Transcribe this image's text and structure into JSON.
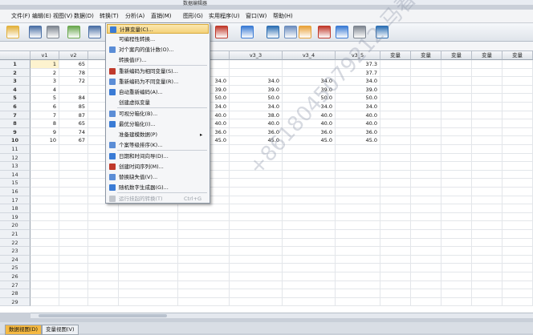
{
  "window": {
    "title": "数据编辑器"
  },
  "menubar": [
    {
      "label": "文件(F)"
    },
    {
      "label": "编辑(E)"
    },
    {
      "label": "视图(V)"
    },
    {
      "label": "数据(D)"
    },
    {
      "label": "转换(T)"
    },
    {
      "label": "分析(A)"
    },
    {
      "label": "直销(M)"
    },
    {
      "label": "图形(G)"
    },
    {
      "label": "实用程序(U)"
    },
    {
      "label": "窗口(W)"
    },
    {
      "label": "帮助(H)"
    }
  ],
  "columns": [
    "v1",
    "v2",
    "",
    "",
    "",
    "v3_3",
    "v3_4",
    "v3_5",
    "变量",
    "变量",
    "变量",
    "变量",
    "变量"
  ],
  "rows": [
    {
      "n": "1",
      "cells": [
        "1",
        "65",
        "",
        "",
        "",
        "",
        "",
        "37.3"
      ]
    },
    {
      "n": "2",
      "cells": [
        "2",
        "78",
        "",
        "",
        "",
        "",
        "",
        "37.7"
      ]
    },
    {
      "n": "3",
      "cells": [
        "3",
        "72",
        "",
        "",
        "34.0",
        "34.0",
        "34.0",
        "34.0"
      ]
    },
    {
      "n": "4",
      "cells": [
        "4",
        "",
        "",
        "",
        "39.0",
        "39.0",
        "39.0",
        "39.0"
      ]
    },
    {
      "n": "5",
      "cells": [
        "5",
        "84",
        "",
        "",
        "50.0",
        "50.0",
        "50.0",
        "50.0"
      ]
    },
    {
      "n": "6",
      "cells": [
        "6",
        "85",
        "",
        "",
        "34.0",
        "34.0",
        "34.0",
        "34.0"
      ]
    },
    {
      "n": "7",
      "cells": [
        "7",
        "87",
        "",
        "",
        "40.0",
        "38.0",
        "40.0",
        "40.0"
      ]
    },
    {
      "n": "8",
      "cells": [
        "8",
        "65",
        "",
        "",
        "40.0",
        "40.0",
        "40.0",
        "40.0"
      ]
    },
    {
      "n": "9",
      "cells": [
        "9",
        "74",
        "",
        "",
        "36.0",
        "36.0",
        "36.0",
        "36.0"
      ]
    },
    {
      "n": "10",
      "cells": [
        "10",
        "67",
        "",
        "",
        "45.0",
        "45.0",
        "45.0",
        "45.0"
      ]
    },
    {
      "n": "11",
      "cells": []
    },
    {
      "n": "12",
      "cells": []
    },
    {
      "n": "13",
      "cells": []
    },
    {
      "n": "14",
      "cells": []
    },
    {
      "n": "15",
      "cells": []
    },
    {
      "n": "16",
      "cells": []
    },
    {
      "n": "17",
      "cells": []
    },
    {
      "n": "18",
      "cells": []
    },
    {
      "n": "19",
      "cells": []
    },
    {
      "n": "20",
      "cells": []
    },
    {
      "n": "21",
      "cells": []
    },
    {
      "n": "22",
      "cells": []
    },
    {
      "n": "23",
      "cells": []
    },
    {
      "n": "24",
      "cells": []
    },
    {
      "n": "25",
      "cells": []
    },
    {
      "n": "26",
      "cells": []
    },
    {
      "n": "27",
      "cells": []
    },
    {
      "n": "28",
      "cells": []
    },
    {
      "n": "29",
      "cells": []
    }
  ],
  "dropdown": {
    "items": [
      {
        "label": "计算变量(C)...",
        "icon": "calculator-icon",
        "highlighted": true
      },
      {
        "label": "可编程性转换...",
        "icon": ""
      },
      {
        "label": "对个案内的值计数(O)...",
        "icon": "count-icon"
      },
      {
        "label": "转换值(F)...",
        "icon": ""
      },
      {
        "label": "重新编码为相同变量(S)...",
        "icon": "recode-same-icon"
      },
      {
        "label": "重新编码为不同变量(R)...",
        "icon": "recode-diff-icon"
      },
      {
        "label": "自动重新编码(A)...",
        "icon": "auto-recode-icon"
      },
      {
        "label": "创建虚拟变量",
        "icon": ""
      },
      {
        "label": "可视分箱化(B)...",
        "icon": "binning-icon"
      },
      {
        "label": "最优分箱化(I)...",
        "icon": "optimal-binning-icon"
      },
      {
        "label": "准备建模数据(P)",
        "icon": "",
        "submenu": true
      },
      {
        "label": "个案等级排序(K)...",
        "icon": "rank-icon"
      },
      {
        "label": "日期和时间向导(D)...",
        "icon": "calendar-icon"
      },
      {
        "label": "创建时间序列(M)...",
        "icon": "timeseries-icon"
      },
      {
        "label": "替换缺失值(V)...",
        "icon": "missing-icon"
      },
      {
        "label": "随机数字生成器(G)...",
        "icon": "random-icon"
      },
      {
        "label": "运行挂起的转换(T)",
        "icon": "run-icon",
        "shortcut": "Ctrl+G",
        "disabled": true
      }
    ]
  },
  "tabs": [
    {
      "label": "数据视图(D)",
      "active": true
    },
    {
      "label": "变量视图(V)",
      "active": false
    }
  ],
  "watermark": "+8618045079212 马春路"
}
